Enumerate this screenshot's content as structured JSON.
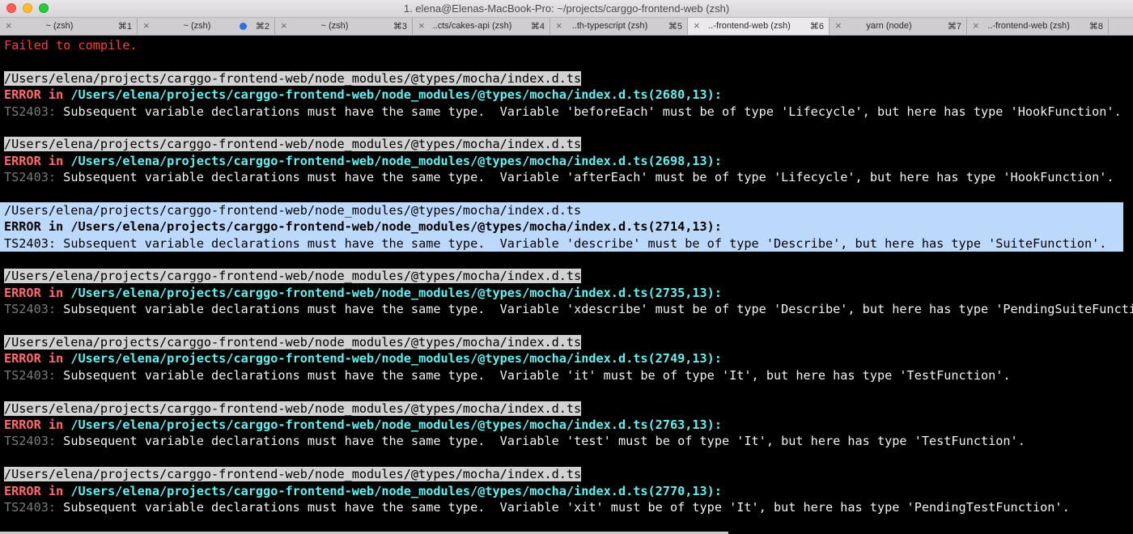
{
  "window": {
    "title": "1. elena@Elenas-MacBook-Pro: ~/projects/carggo-frontend-web (zsh)"
  },
  "tabs": [
    {
      "label": "~ (zsh)",
      "shortcut": "⌘1",
      "active": false,
      "dot": false
    },
    {
      "label": "~ (zsh)",
      "shortcut": "⌘2",
      "active": false,
      "dot": true
    },
    {
      "label": "~ (zsh)",
      "shortcut": "⌘3",
      "active": false,
      "dot": false
    },
    {
      "label": "..cts/cakes-api (zsh)",
      "shortcut": "⌘4",
      "active": false,
      "dot": false
    },
    {
      "label": "..th-typescript (zsh)",
      "shortcut": "⌘5",
      "active": false,
      "dot": false
    },
    {
      "label": "..-frontend-web (zsh)",
      "shortcut": "⌘6",
      "active": true,
      "dot": false
    },
    {
      "label": "yarn (node)",
      "shortcut": "⌘7",
      "active": false,
      "dot": false
    },
    {
      "label": "..-frontend-web (zsh)",
      "shortcut": "⌘8",
      "active": false,
      "dot": false
    }
  ],
  "terminal": {
    "failed": "Failed to compile.",
    "blocks": [
      {
        "path": "/Users/elena/projects/carggo-frontend-web/node_modules/@types/mocha/index.d.ts",
        "err_label": "ERROR in",
        "err_path": "/Users/elena/projects/carggo-frontend-web/node_modules/@types/mocha/index.d.ts(2680,13):",
        "code": "TS2403:",
        "message": "Subsequent variable declarations must have the same type.  Variable 'beforeEach' must be of type 'Lifecycle', but here has type 'HookFunction'.",
        "selected": false
      },
      {
        "path": "/Users/elena/projects/carggo-frontend-web/node_modules/@types/mocha/index.d.ts",
        "err_label": "ERROR in",
        "err_path": "/Users/elena/projects/carggo-frontend-web/node_modules/@types/mocha/index.d.ts(2698,13):",
        "code": "TS2403:",
        "message": "Subsequent variable declarations must have the same type.  Variable 'afterEach' must be of type 'Lifecycle', but here has type 'HookFunction'.",
        "selected": false
      },
      {
        "path": "/Users/elena/projects/carggo-frontend-web/node_modules/@types/mocha/index.d.ts",
        "err_label": "ERROR in",
        "err_path": "/Users/elena/projects/carggo-frontend-web/node_modules/@types/mocha/index.d.ts(2714,13):",
        "code": "TS2403:",
        "message": "Subsequent variable declarations must have the same type.  Variable 'describe' must be of type 'Describe', but here has type 'SuiteFunction'.",
        "selected": true
      },
      {
        "path": "/Users/elena/projects/carggo-frontend-web/node_modules/@types/mocha/index.d.ts",
        "err_label": "ERROR in",
        "err_path": "/Users/elena/projects/carggo-frontend-web/node_modules/@types/mocha/index.d.ts(2735,13):",
        "code": "TS2403:",
        "message": "Subsequent variable declarations must have the same type.  Variable 'xdescribe' must be of type 'Describe', but here has type 'PendingSuiteFunction'.",
        "selected": false
      },
      {
        "path": "/Users/elena/projects/carggo-frontend-web/node_modules/@types/mocha/index.d.ts",
        "err_label": "ERROR in",
        "err_path": "/Users/elena/projects/carggo-frontend-web/node_modules/@types/mocha/index.d.ts(2749,13):",
        "code": "TS2403:",
        "message": "Subsequent variable declarations must have the same type.  Variable 'it' must be of type 'It', but here has type 'TestFunction'.",
        "selected": false
      },
      {
        "path": "/Users/elena/projects/carggo-frontend-web/node_modules/@types/mocha/index.d.ts",
        "err_label": "ERROR in",
        "err_path": "/Users/elena/projects/carggo-frontend-web/node_modules/@types/mocha/index.d.ts(2763,13):",
        "code": "TS2403:",
        "message": "Subsequent variable declarations must have the same type.  Variable 'test' must be of type 'It', but here has type 'TestFunction'.",
        "selected": false
      },
      {
        "path": "/Users/elena/projects/carggo-frontend-web/node_modules/@types/mocha/index.d.ts",
        "err_label": "ERROR in",
        "err_path": "/Users/elena/projects/carggo-frontend-web/node_modules/@types/mocha/index.d.ts(2770,13):",
        "code": "TS2403:",
        "message": "Subsequent variable declarations must have the same type.  Variable 'xit' must be of type 'It', but here has type 'PendingTestFunction'.",
        "selected": false
      }
    ]
  }
}
